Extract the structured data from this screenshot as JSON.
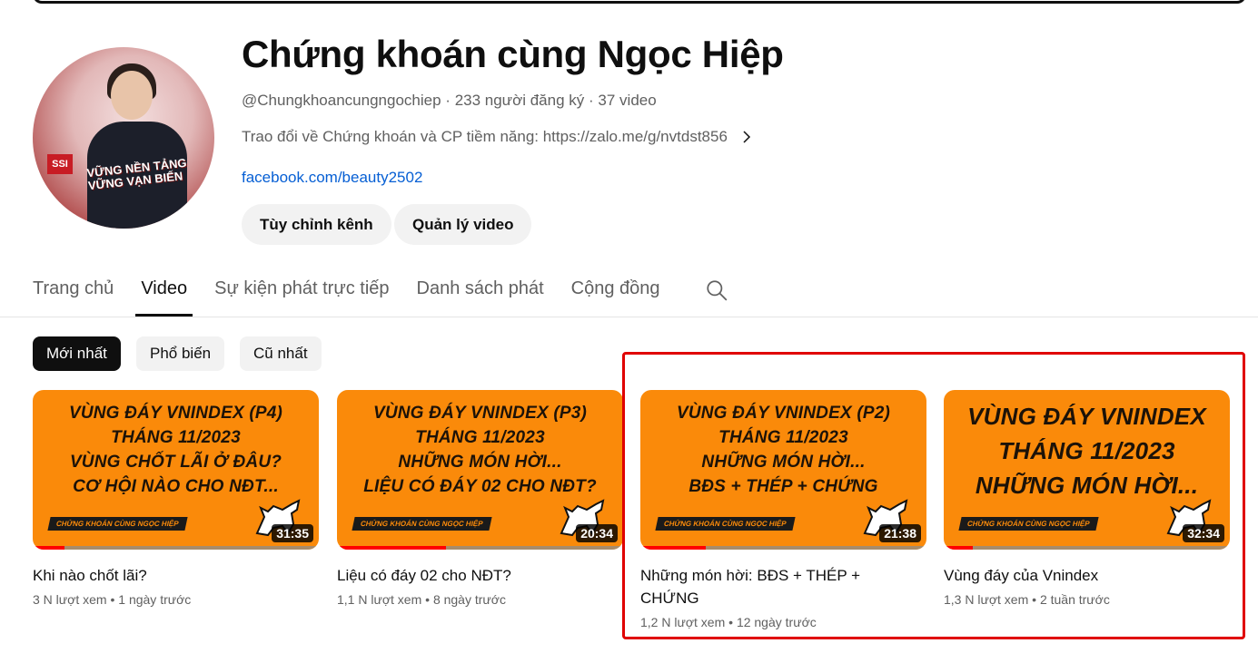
{
  "channel": {
    "name": "Chứng khoán cùng Ngọc Hiệp",
    "handle": "@Chungkhoancungngochiep",
    "subscribers": "233 người đăng ký",
    "video_count": "37 video",
    "description": "Trao đổi về Chứng khoán và CP tiềm năng: https://zalo.me/g/nvtdst856",
    "link": "facebook.com/beauty2502",
    "avatar_badge": "SSI",
    "avatar_slogan": "VỮNG NỀN TẢNG VỮNG VẠN BIẾN"
  },
  "actions": {
    "customize": "Tùy chỉnh kênh",
    "manage": "Quản lý video"
  },
  "tabs": [
    {
      "label": "Trang chủ"
    },
    {
      "label": "Video"
    },
    {
      "label": "Sự kiện phát trực tiếp"
    },
    {
      "label": "Danh sách phát"
    },
    {
      "label": "Cộng đồng"
    }
  ],
  "filters": [
    {
      "label": "Mới nhất"
    },
    {
      "label": "Phổ biến"
    },
    {
      "label": "Cũ nhất"
    }
  ],
  "videos": [
    {
      "thumb_lines": [
        "VÙNG ĐÁY VNINDEX (P4)",
        "THÁNG 11/2023",
        "VÙNG CHỐT LÃI Ở ĐÂU?",
        "CƠ HỘI NÀO CHO NĐT..."
      ],
      "brand": "CHỨNG KHOÁN CÙNG NGỌC HIỆP",
      "duration": "31:35",
      "progress": 0.11,
      "title": "Khi nào chốt lãi?",
      "views": "3 N lượt xem",
      "age": "1 ngày trước"
    },
    {
      "thumb_lines": [
        "VÙNG ĐÁY VNINDEX (P3)",
        "THÁNG 11/2023",
        "NHỮNG MÓN HỜI...",
        "LIỆU CÓ ĐÁY 02 CHO NĐT?"
      ],
      "brand": "CHỨNG KHOÁN CÙNG NGỌC HIỆP",
      "duration": "20:34",
      "progress": 0.38,
      "title": "Liệu có đáy 02 cho NĐT?",
      "views": "1,1 N lượt xem",
      "age": "8 ngày trước"
    },
    {
      "thumb_lines": [
        "VÙNG ĐÁY VNINDEX (P2)",
        "THÁNG 11/2023",
        "NHỮNG MÓN HỜI...",
        "BĐS + THÉP + CHỨNG"
      ],
      "brand": "CHỨNG KHOÁN CÙNG NGỌC HIỆP",
      "duration": "21:38",
      "progress": 0.23,
      "title": "Những món hời: BĐS + THÉP + CHỨNG",
      "views": "1,2 N lượt xem",
      "age": "12 ngày trước"
    },
    {
      "thumb_lines": [
        "VÙNG ĐÁY VNINDEX",
        "THÁNG 11/2023",
        "NHỮNG MÓN HỜI..."
      ],
      "brand": "CHỨNG KHOÁN CÙNG NGỌC HIỆP",
      "duration": "32:34",
      "progress": 0.1,
      "title": "Vùng đáy của Vnindex",
      "views": "1,3 N lượt xem",
      "age": "2 tuần trước"
    }
  ],
  "separators": {
    "dot": "·",
    "bullet": "•"
  },
  "icons": [
    "chevron-right-icon",
    "search-icon",
    "bull-icon"
  ],
  "colors": {
    "link": "#065fd4",
    "thumb_orange": "#fa8a0a",
    "progress": "#ff0000",
    "highlight": "#e00000"
  }
}
